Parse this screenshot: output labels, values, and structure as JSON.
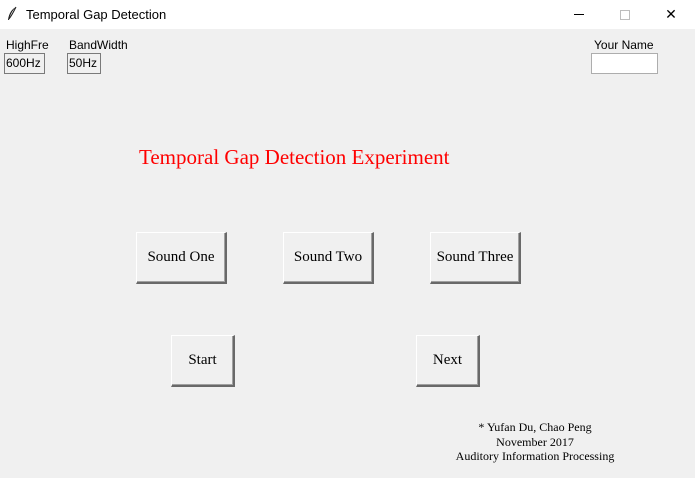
{
  "window": {
    "title": "Temporal Gap Detection",
    "minimize_icon": "minimize-icon",
    "maximize_icon": "maximize-icon",
    "close_icon": "close-icon",
    "close_glyph": "✕"
  },
  "params": {
    "highfre_label": "HighFre",
    "highfre_value": "600Hz",
    "bandwidth_label": "BandWidth",
    "bandwidth_value": "50Hz"
  },
  "name_field": {
    "label": "Your Name",
    "value": ""
  },
  "heading": {
    "text": "Temporal Gap Detection Experiment",
    "color": "#ff0000"
  },
  "buttons": {
    "sound_one": "Sound One",
    "sound_two": "Sound Two",
    "sound_three": "Sound Three",
    "start": "Start",
    "next": "Next"
  },
  "credits": {
    "authors": "* Yufan Du, Chao Peng",
    "date": "November 2017",
    "course": "Auditory Information Processing"
  }
}
